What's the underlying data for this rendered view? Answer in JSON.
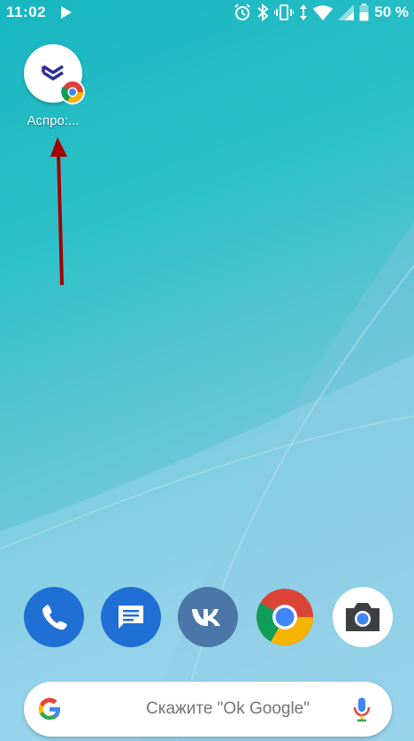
{
  "status_bar": {
    "time": "11:02",
    "battery_percent": "50 %",
    "icons": [
      "play-icon",
      "alarm-icon",
      "bluetooth-icon",
      "vibrate-icon",
      "data-arrows-icon",
      "wifi-icon",
      "signal-icon",
      "battery-icon"
    ]
  },
  "home": {
    "shortcut": {
      "label": "Аспро:...",
      "icon": "aspro-shortcut-icon",
      "badge": "chrome-badge-icon"
    }
  },
  "dock": {
    "apps": [
      {
        "name": "phone",
        "icon": "phone-icon",
        "color": "#1f6fd4"
      },
      {
        "name": "messages",
        "icon": "messages-icon",
        "color": "#1f6fd4"
      },
      {
        "name": "vk",
        "icon": "vk-icon",
        "color": "#4a76a8"
      },
      {
        "name": "chrome",
        "icon": "chrome-icon",
        "color": "#db4437"
      },
      {
        "name": "camera",
        "icon": "camera-icon",
        "color": "#3c4043"
      }
    ]
  },
  "search": {
    "placeholder": "Скажите \"Ok Google\""
  },
  "colors": {
    "accent_arrow": "#b30000",
    "wallpaper_top": "#17b6c0",
    "wallpaper_bottom": "#9fd6ee"
  }
}
